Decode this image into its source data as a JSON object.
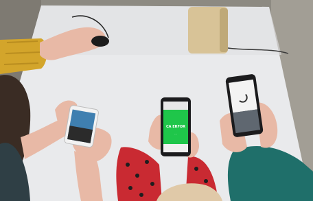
{
  "scene": {
    "palette": {
      "table": "#e9eaec",
      "floor": "#8d8a82",
      "yellow_sleeve": "#d3a52b",
      "red_sleeve": "#c92a32",
      "teal_sleeve": "#1f6f6a",
      "skin": "#e8b9a6",
      "phone_dark": "#1b1b1d",
      "phone_white": "#f2f2f2",
      "screen_green": "#1fc64a"
    },
    "green_phone": {
      "heading": "CA ERFOR",
      "body_text": "..."
    }
  }
}
